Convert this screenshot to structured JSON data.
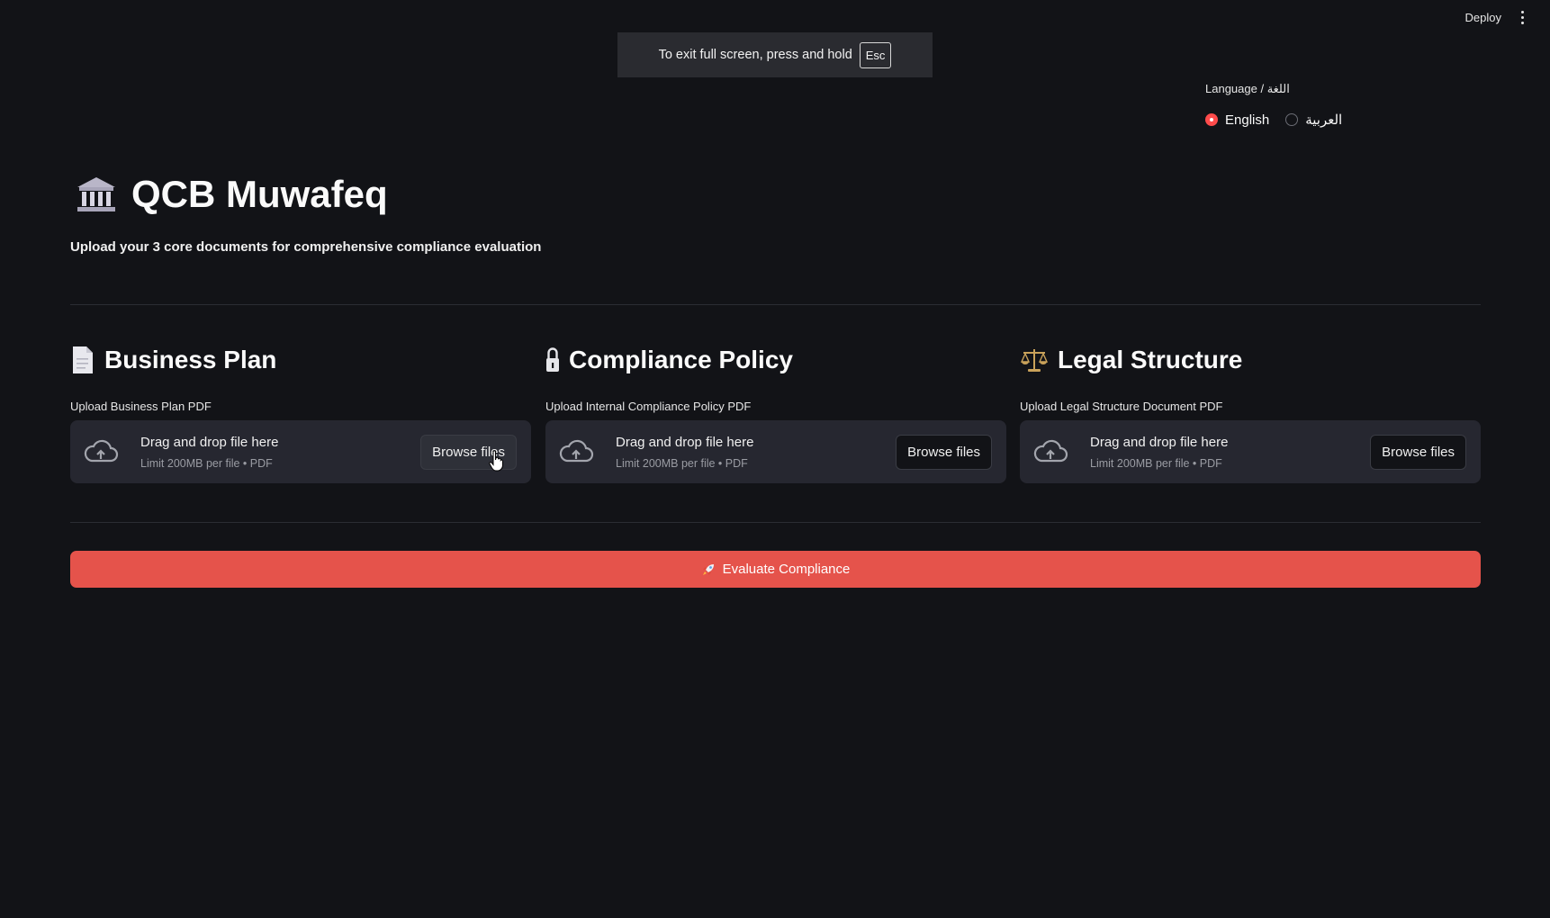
{
  "header": {
    "deploy_label": "Deploy",
    "fullscreen_notice": "To exit full screen, press and hold",
    "fullscreen_key": "Esc"
  },
  "language": {
    "label": "Language / اللغة",
    "options": [
      {
        "label": "English",
        "selected": true
      },
      {
        "label": "العربية",
        "selected": false
      }
    ]
  },
  "page": {
    "title": "QCB Muwafeq",
    "title_icon": "bank-icon",
    "subtitle": "Upload your 3 core documents for comprehensive compliance evaluation"
  },
  "uploads": [
    {
      "title": "Business Plan",
      "icon": "page-icon",
      "label": "Upload Business Plan PDF",
      "drop_text": "Drag and drop file here",
      "limit_text": "Limit 200MB per file • PDF",
      "browse_label": "Browse files"
    },
    {
      "title": "Compliance Policy",
      "icon": "lock-icon",
      "label": "Upload Internal Compliance Policy PDF",
      "drop_text": "Drag and drop file here",
      "limit_text": "Limit 200MB per file • PDF",
      "browse_label": "Browse files"
    },
    {
      "title": "Legal Structure",
      "icon": "scales-icon",
      "label": "Upload Legal Structure Document PDF",
      "drop_text": "Drag and drop file here",
      "limit_text": "Limit 200MB per file • PDF",
      "browse_label": "Browse files"
    }
  ],
  "actions": {
    "evaluate_label": "Evaluate Compliance",
    "evaluate_icon": "rocket-icon"
  },
  "colors": {
    "background": "#121317",
    "dropzone": "#262730",
    "accent": "#ff4b4b",
    "primary_button": "#e5534b"
  }
}
